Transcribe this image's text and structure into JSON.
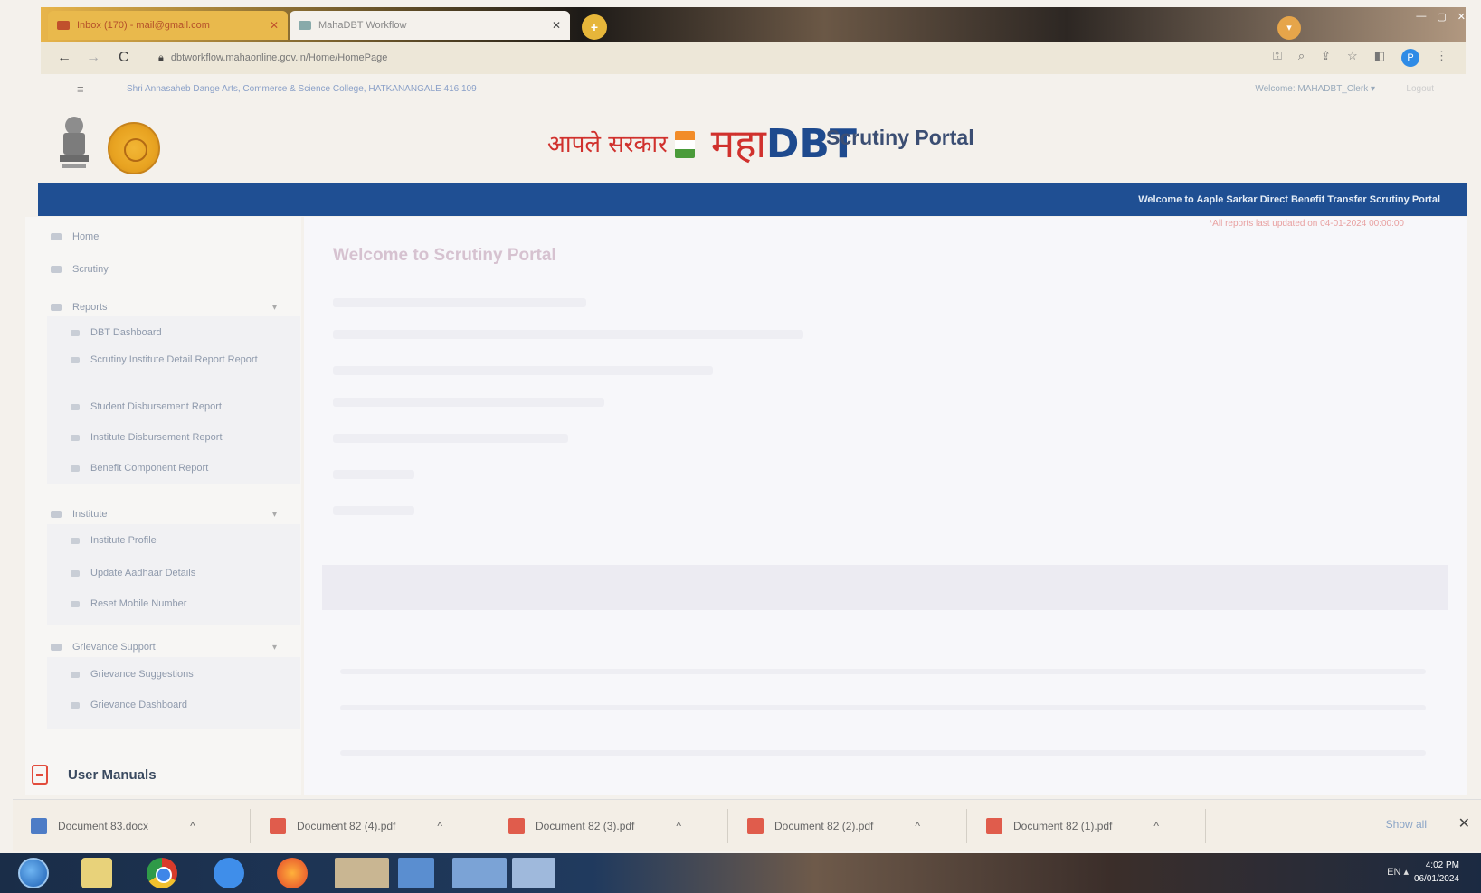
{
  "browser": {
    "tabs": [
      {
        "label": "Inbox (170) - mail@gmail.com"
      },
      {
        "label": "MahaDBT Workflow"
      }
    ],
    "new_tab_label": "+",
    "url": "dbtworkflow.mahaonline.gov.in/Home/HomePage",
    "nav": {
      "back": "←",
      "forward": "→",
      "reload": "C"
    },
    "profile_initial": "P"
  },
  "infoline": {
    "menu_icon": "≡",
    "college": "Shri Annasaheb Dange Arts, Commerce & Science College, HATKANANGALE 416 109",
    "user": "Welcome: MAHADBT_Clerk ▾",
    "logout": "Logout"
  },
  "header": {
    "logo_aaple": "आपले सरकार",
    "logo_maha": "महा",
    "logo_dbt": "DBT",
    "portal_title": "Scrutiny Portal"
  },
  "banner": {
    "text": "Welcome to Aaple Sarkar Direct Benefit Transfer Scrutiny Portal"
  },
  "sidebar": {
    "items": [
      {
        "label": "Home"
      },
      {
        "label": "Scrutiny"
      },
      {
        "label": "Reports",
        "chevron": "▾"
      },
      {
        "label": "Institute",
        "chevron": "▾"
      },
      {
        "label": "Grievance Support",
        "chevron": "▾"
      }
    ],
    "reports_sub": [
      {
        "label": "DBT Dashboard"
      },
      {
        "label": "Scrutiny Institute Detail Report Report"
      },
      {
        "label": "Student Disbursement Report"
      },
      {
        "label": "Institute Disbursement Report"
      },
      {
        "label": "Benefit Component Report"
      }
    ],
    "institute_sub": [
      {
        "label": "Institute Profile"
      },
      {
        "label": "Update Aadhaar Details"
      },
      {
        "label": "Reset Mobile Number"
      }
    ],
    "grievance_sub": [
      {
        "label": "Grievance Suggestions"
      },
      {
        "label": "Grievance Dashboard"
      }
    ],
    "manuals_label": "User Manuals"
  },
  "main": {
    "refresh_note": "*All reports last updated on 04-01-2024 00:00:00",
    "heading": "Welcome to Scrutiny Portal"
  },
  "downloads": {
    "items": [
      {
        "name": "Document 83.docx",
        "type": "doc"
      },
      {
        "name": "Document 82 (4).pdf",
        "type": "pdf"
      },
      {
        "name": "Document 82 (3).pdf",
        "type": "pdf"
      },
      {
        "name": "Document 82 (2).pdf",
        "type": "pdf"
      },
      {
        "name": "Document 82 (1).pdf",
        "type": "pdf"
      }
    ],
    "caret": "^",
    "show_all": "Show all",
    "close": "✕"
  },
  "taskbar": {
    "tray": "EN ▴",
    "time": "4:02 PM",
    "date": "06/01/2024"
  }
}
